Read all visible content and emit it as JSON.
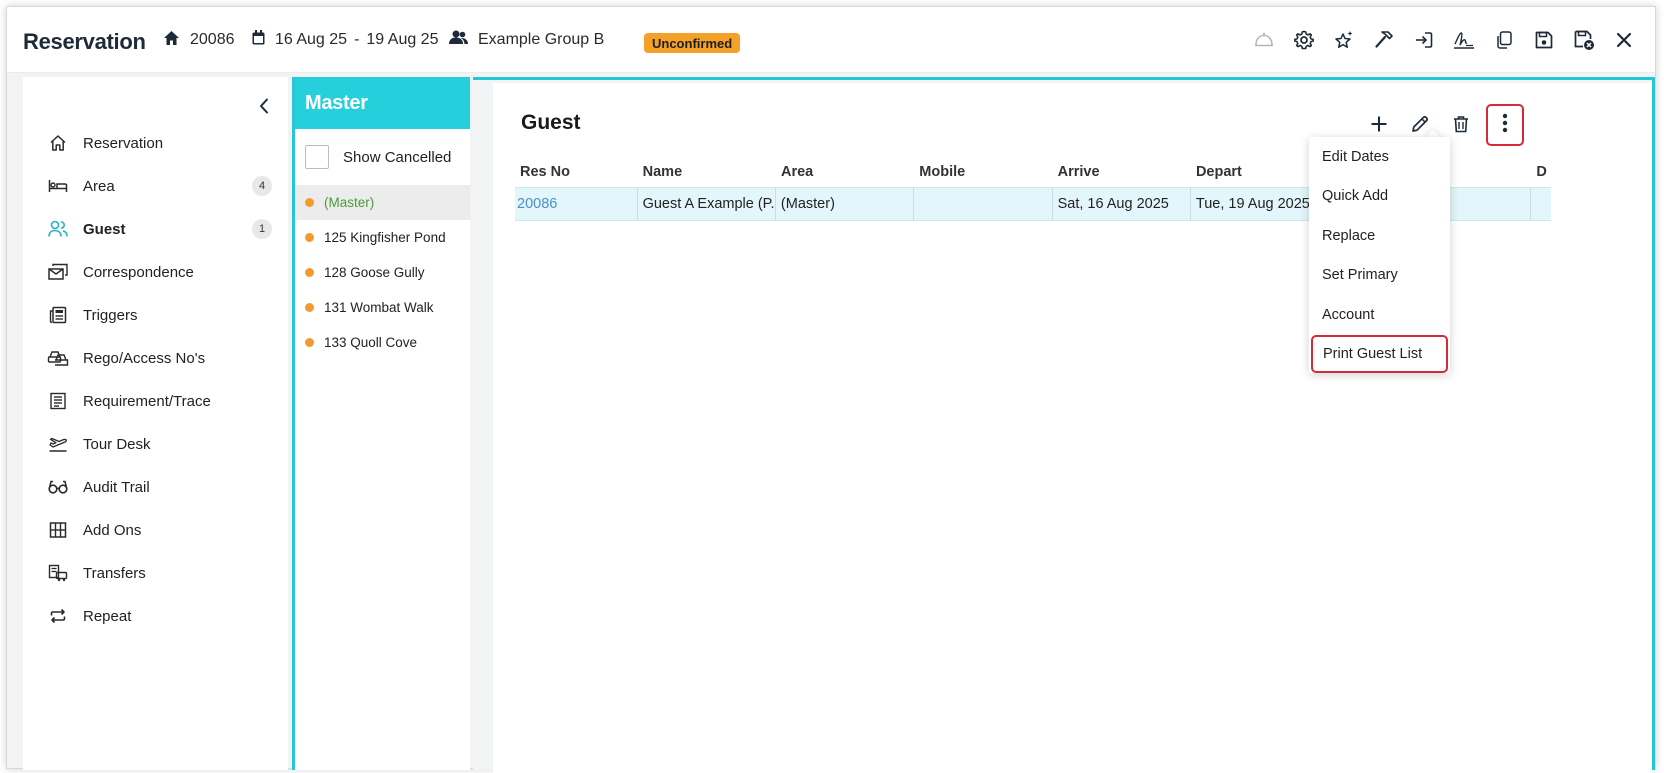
{
  "header": {
    "title": "Reservation",
    "res_no": "20086",
    "date_from": "16 Aug 25",
    "date_sep": "-",
    "date_to": "19 Aug 25",
    "group": "Example Group B",
    "status": "Unconfirmed",
    "icons": [
      "bell-icon",
      "gear-icon",
      "sparkle-star-icon",
      "hammer-icon",
      "sign-in-icon",
      "signature-icon",
      "copy-icon",
      "save-icon",
      "save-close-icon",
      "close-icon"
    ]
  },
  "sidebar": {
    "items": [
      {
        "label": "Reservation",
        "icon": "home-icon"
      },
      {
        "label": "Area",
        "icon": "bed-icon",
        "count": "4"
      },
      {
        "label": "Guest",
        "icon": "users-icon",
        "count": "1",
        "active": true
      },
      {
        "label": "Correspondence",
        "icon": "mail-icon"
      },
      {
        "label": "Triggers",
        "icon": "newspaper-icon"
      },
      {
        "label": "Rego/Access No's",
        "icon": "car-icon"
      },
      {
        "label": "Requirement/Trace",
        "icon": "checklist-icon"
      },
      {
        "label": "Tour Desk",
        "icon": "plane-icon"
      },
      {
        "label": "Audit Trail",
        "icon": "glasses-icon"
      },
      {
        "label": "Add Ons",
        "icon": "grid-icon"
      },
      {
        "label": "Transfers",
        "icon": "bus-icon"
      },
      {
        "label": "Repeat",
        "icon": "repeat-icon"
      }
    ]
  },
  "master": {
    "title": "Master",
    "show_cancelled": "Show Cancelled",
    "items": [
      "(Master)",
      "125 Kingfisher Pond",
      "128 Goose Gully",
      "131 Wombat Walk",
      "133 Quoll Cove"
    ]
  },
  "main": {
    "title": "Guest",
    "columns": [
      "Res No",
      "Name",
      "Area",
      "Mobile",
      "Arrive",
      "Depart",
      "",
      "D"
    ],
    "rows": [
      {
        "res_no": "20086",
        "name": "Guest A Example (P...",
        "area": "(Master)",
        "mobile": "",
        "arrive": "Sat, 16 Aug 2025",
        "depart": "Tue, 19 Aug 2025"
      }
    ]
  },
  "menu": {
    "items": [
      "Edit Dates",
      "Quick Add",
      "Replace",
      "Set Primary",
      "Account",
      "Print Guest List"
    ]
  },
  "colors": {
    "accent": "#26cfdc",
    "badge": "#f5a028",
    "highlight": "#d42a3a",
    "link": "#4a90c8"
  }
}
